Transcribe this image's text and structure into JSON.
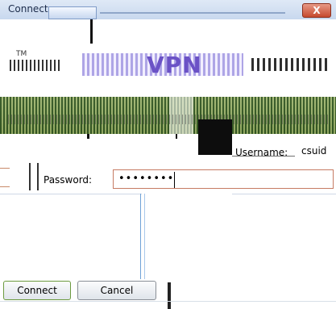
{
  "window": {
    "title": "Connect",
    "close_glyph": "X",
    "close_icon": "close-icon"
  },
  "banner": {
    "trademark": "TM",
    "logo_text": "VPN",
    "brand_colors": {
      "logo": "#6b52c6",
      "banner_stripes": "#8ea068"
    }
  },
  "form": {
    "username_label": "Username:",
    "username_value": "csuid",
    "password_label": "Password:",
    "password_value": "••••••••"
  },
  "buttons": {
    "connect": "Connect",
    "cancel": "Cancel"
  }
}
